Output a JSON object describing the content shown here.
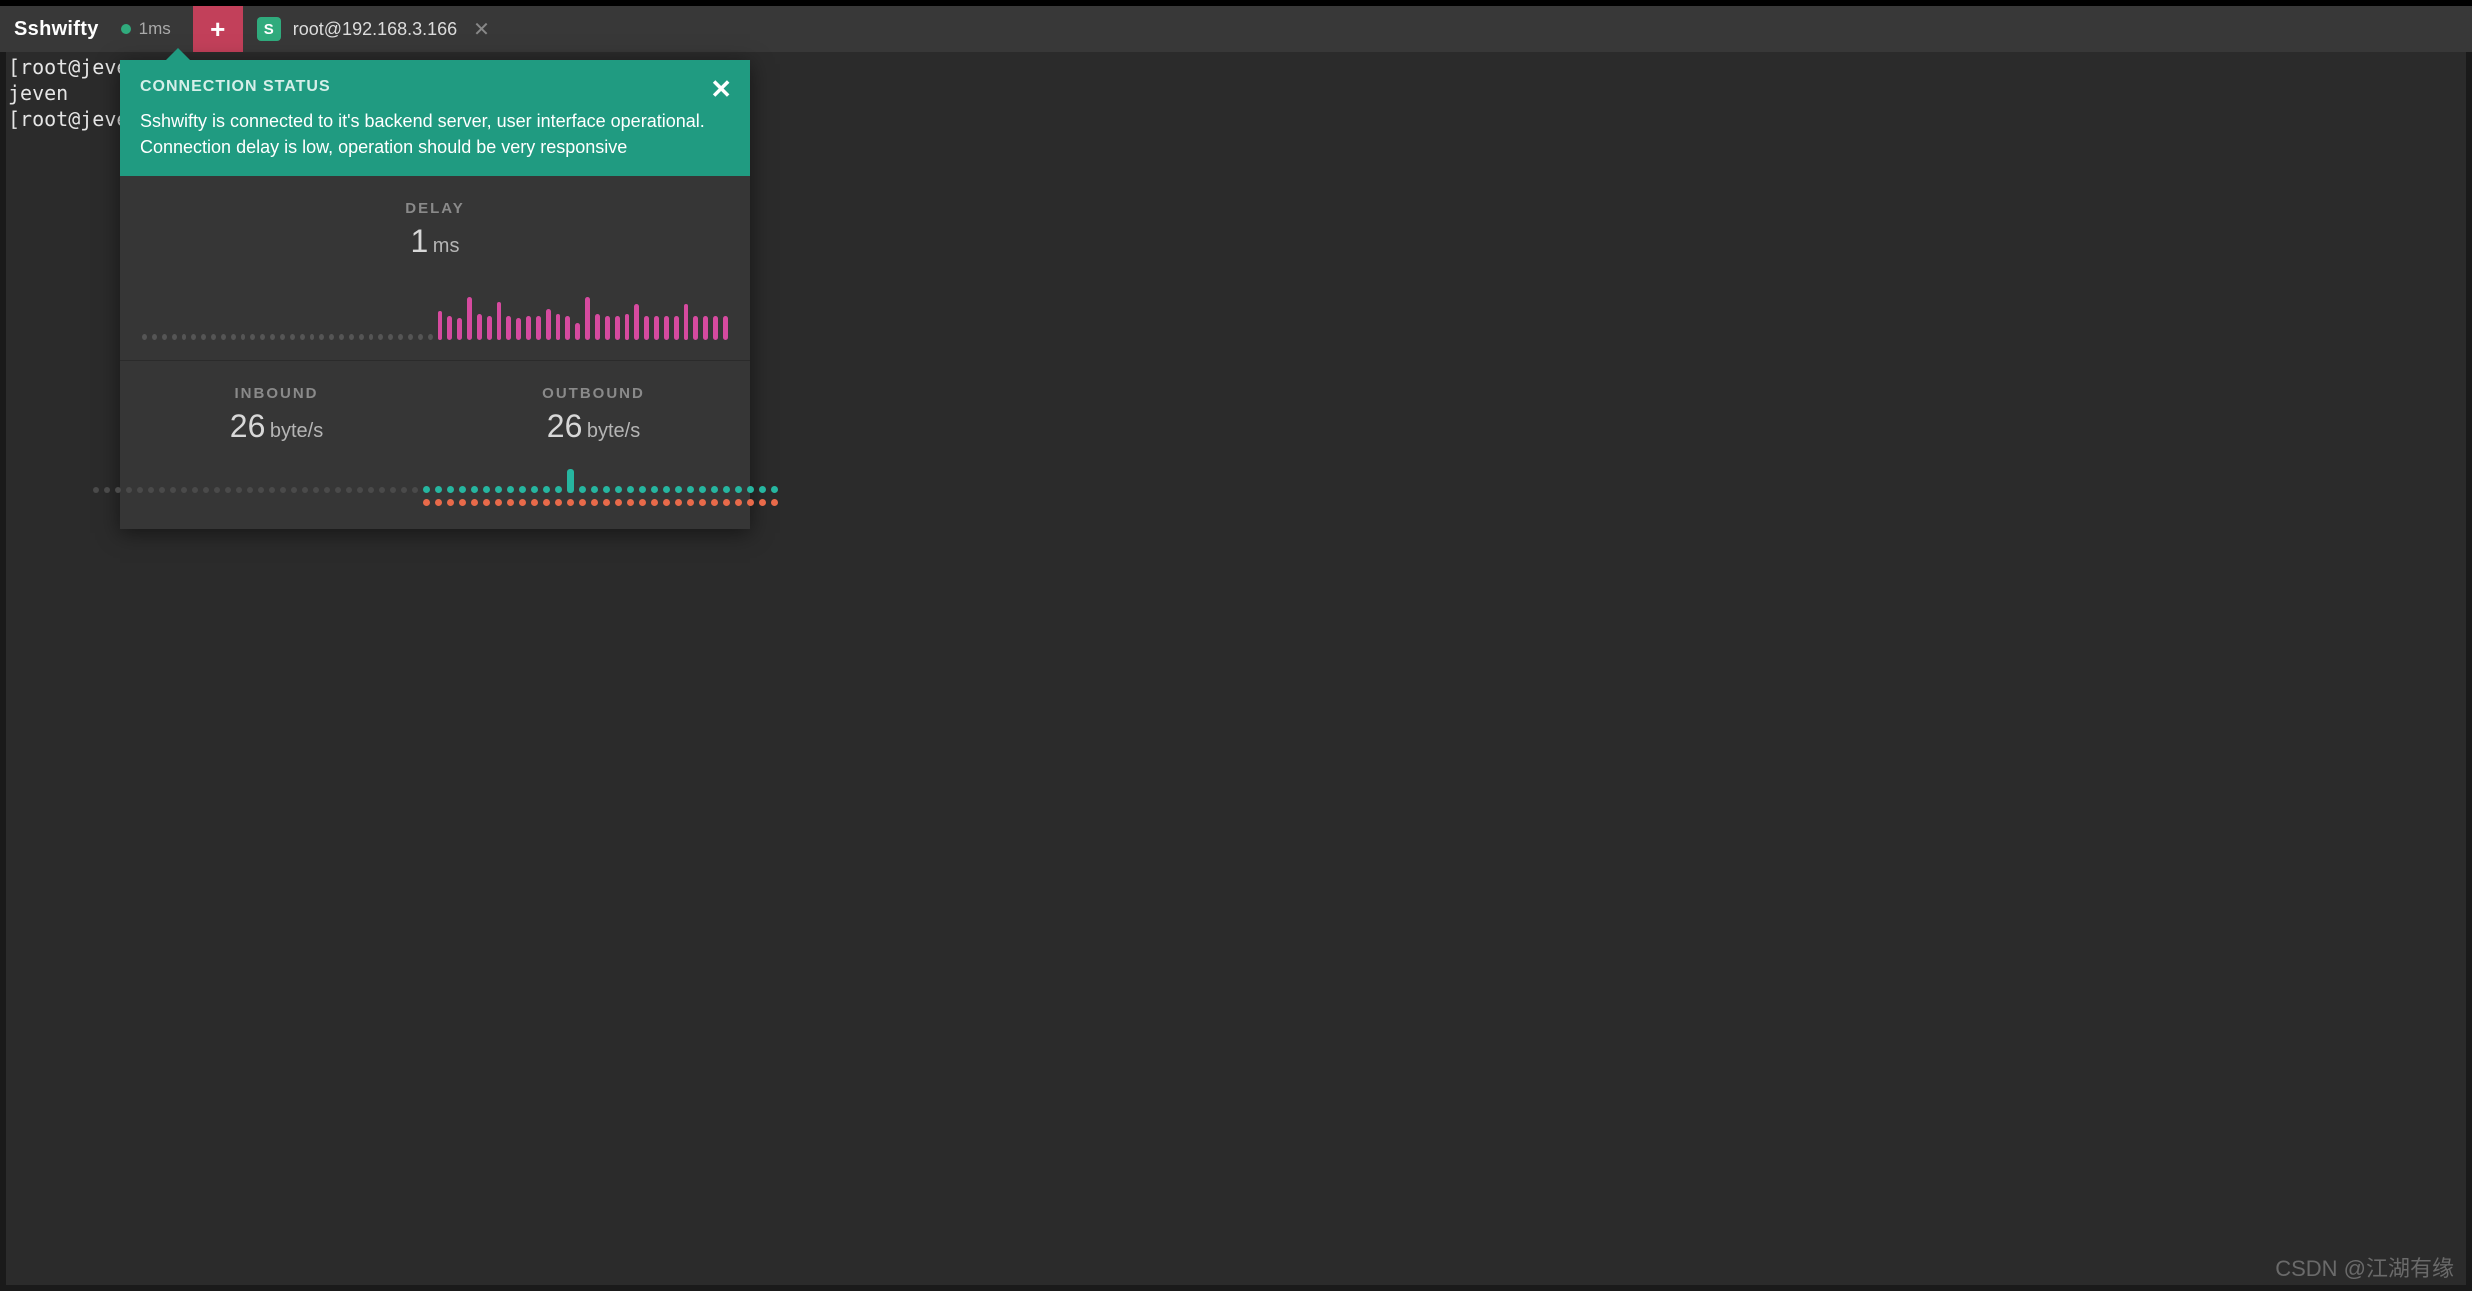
{
  "header": {
    "brand": "Sshwifty",
    "status_latency": "1ms",
    "add_label": "+",
    "tab": {
      "icon_letter": "S",
      "title": "root@192.168.3.166",
      "close": "✕"
    }
  },
  "terminal": {
    "lines": [
      "[root@jeve",
      "jeven",
      "[root@jeve"
    ]
  },
  "popover": {
    "title": "CONNECTION STATUS",
    "description": "Sshwifty is connected to it's backend server, user interface operational. Connection delay is low, operation should be very responsive",
    "close": "✕",
    "delay": {
      "label": "DELAY",
      "value": "1",
      "unit": "ms"
    },
    "inbound": {
      "label": "INBOUND",
      "value": "26",
      "unit": "byte/s"
    },
    "outbound": {
      "label": "OUTBOUND",
      "value": "26",
      "unit": "byte/s"
    }
  },
  "chart_data": {
    "delay_sparkline": {
      "type": "bar",
      "title": "Connection delay over time",
      "ylabel": "ms",
      "ylim": [
        0,
        2
      ],
      "inactive_leading_points": 30,
      "values": [
        1.2,
        1.0,
        0.9,
        1.8,
        1.1,
        1.0,
        1.6,
        1.0,
        0.9,
        1.0,
        1.0,
        1.3,
        1.1,
        1.0,
        0.7,
        1.8,
        1.1,
        1.0,
        1.0,
        1.1,
        1.5,
        1.0,
        1.0,
        1.0,
        1.0,
        1.5,
        1.0,
        1.0,
        1.0,
        1.0
      ]
    },
    "traffic_sparkline": {
      "type": "bar",
      "title": "Inbound/Outbound traffic",
      "ylabel": "byte/s",
      "inactive_leading_points": 30,
      "series": [
        {
          "name": "inbound",
          "color": "#26b6a0",
          "values": [
            7,
            7,
            7,
            7,
            7,
            7,
            7,
            7,
            7,
            7,
            7,
            7,
            24,
            7,
            7,
            7,
            7,
            7,
            7,
            7,
            7,
            7,
            7,
            7,
            7,
            7,
            7,
            7,
            7,
            7
          ]
        },
        {
          "name": "outbound",
          "color": "#e86a4a",
          "values": [
            7,
            7,
            7,
            7,
            7,
            7,
            7,
            7,
            7,
            7,
            7,
            7,
            7,
            7,
            7,
            7,
            7,
            7,
            7,
            7,
            7,
            7,
            7,
            7,
            7,
            7,
            7,
            7,
            7,
            7
          ]
        }
      ]
    }
  },
  "watermark": "CSDN @江湖有缘"
}
